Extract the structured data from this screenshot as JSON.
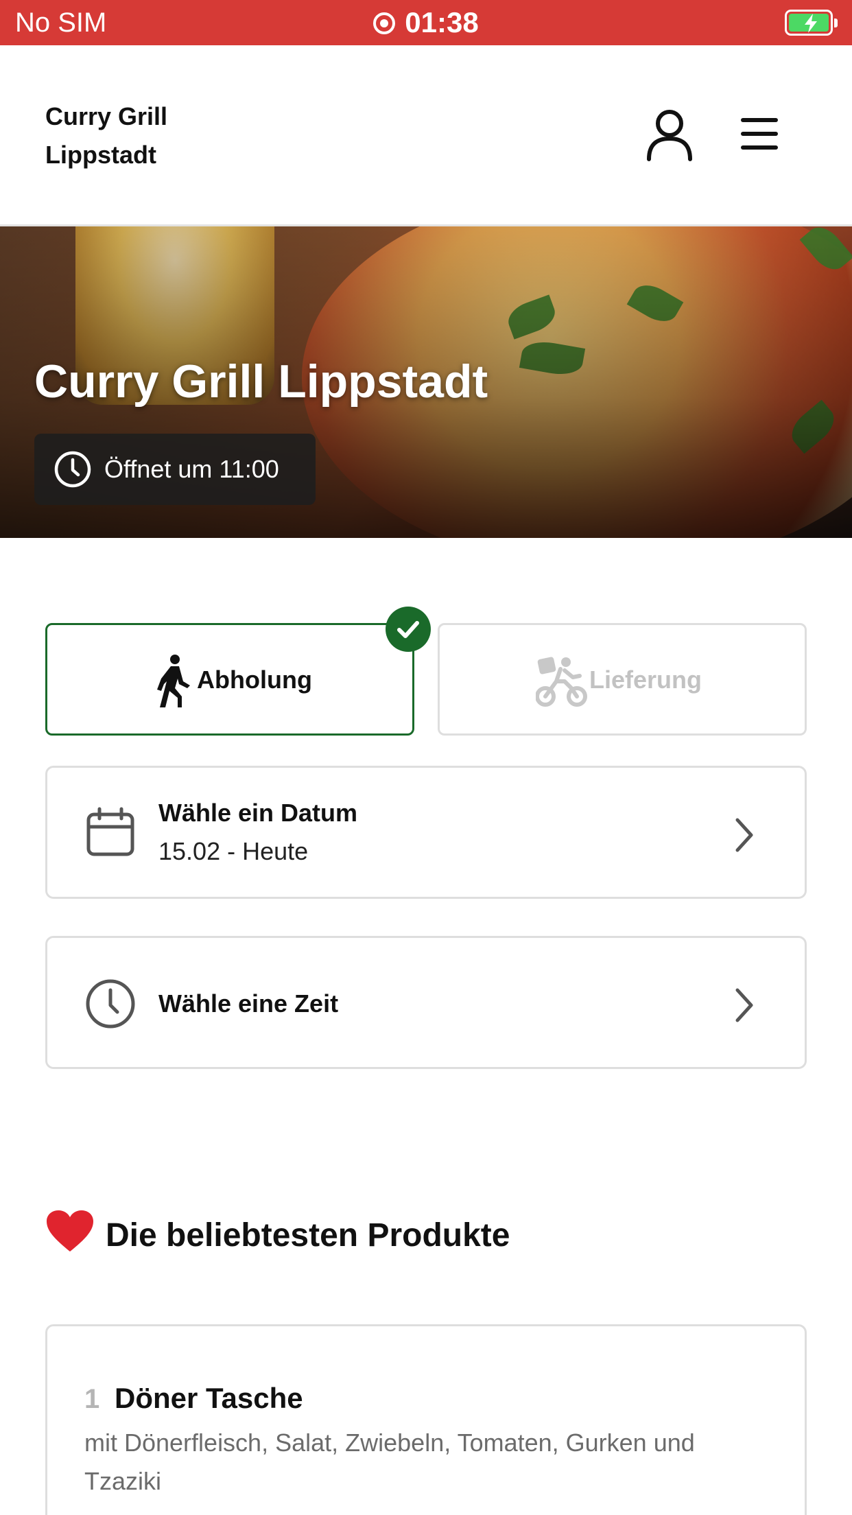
{
  "status_bar": {
    "carrier": "No SIM",
    "time": "01:38"
  },
  "header": {
    "brand": "Curry Grill Lippstadt"
  },
  "hero": {
    "title": "Curry Grill Lippstadt",
    "open_status": "Öffnet um 11:00"
  },
  "order_mode": {
    "pickup_label": "Abholung",
    "delivery_label": "Lieferung",
    "selected": "pickup"
  },
  "date_selector": {
    "title": "Wähle ein Datum",
    "value": "15.02 - Heute"
  },
  "time_selector": {
    "title": "Wähle eine Zeit"
  },
  "popular": {
    "title": "Die beliebtesten Produkte",
    "products": [
      {
        "rank": "1",
        "name": "Döner Tasche",
        "description": "mit Dönerfleisch, Salat, Zwiebeln, Tomaten, Gurken und Tzaziki"
      }
    ]
  },
  "colors": {
    "status_bar": "#d63a36",
    "selected_border": "#1a6a2a",
    "check_badge": "#1a6a2a"
  },
  "icons": [
    "record-icon",
    "battery-icon",
    "user-icon",
    "menu-icon",
    "clock-icon",
    "walking-icon",
    "bike-delivery-icon",
    "check-icon",
    "calendar-icon",
    "chevron-right-icon",
    "heart-icon"
  ]
}
